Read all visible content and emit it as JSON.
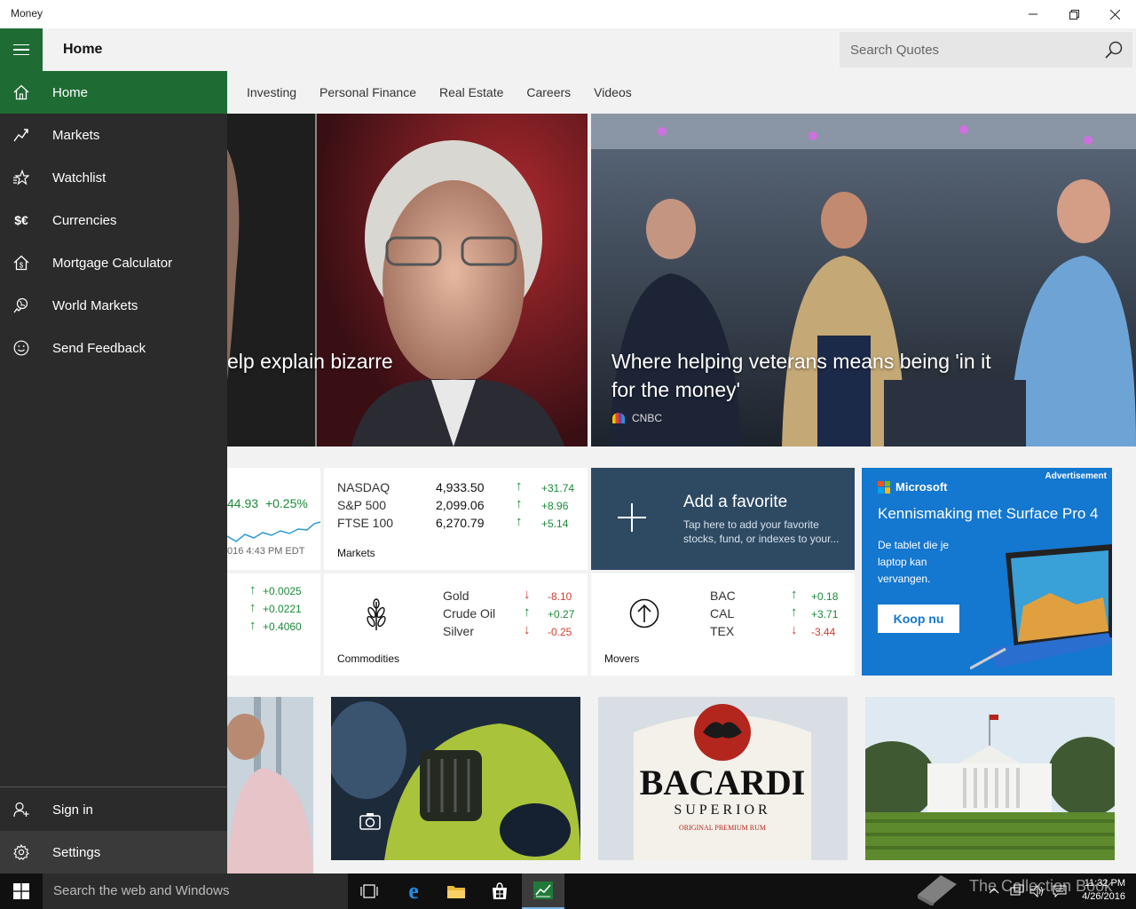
{
  "window": {
    "title": "Money",
    "min_icon": "minimize-icon",
    "max_icon": "restore-icon",
    "close_icon": "close-icon"
  },
  "header": {
    "page_title": "Home",
    "menu_icon": "hamburger-icon"
  },
  "search": {
    "placeholder": "Search Quotes",
    "icon": "search-icon"
  },
  "categories": [
    "Investing",
    "Personal Finance",
    "Real Estate",
    "Careers",
    "Videos"
  ],
  "hero": [
    {
      "headline": "elp explain bizarre"
    },
    {
      "headline": "Where helping veterans means being 'in it for the money'",
      "source": "CNBC"
    }
  ],
  "index_tile": {
    "value": "44.93",
    "change": "+0.25%",
    "timestamp": "016 4:43 PM EDT"
  },
  "markets_tile": {
    "label": "Markets",
    "rows": [
      {
        "name": "NASDAQ",
        "value": "4,933.50",
        "change": "+31.74",
        "dir": "up"
      },
      {
        "name": "S&P 500",
        "value": "2,099.06",
        "change": "+8.96",
        "dir": "up"
      },
      {
        "name": "FTSE 100",
        "value": "6,270.79",
        "change": "+5.14",
        "dir": "up"
      }
    ]
  },
  "currencies_tile": {
    "rows": [
      "+0.0025",
      "+0.0221",
      "+0.4060"
    ]
  },
  "commodities_tile": {
    "label": "Commodities",
    "icon": "wheat-icon",
    "rows": [
      {
        "name": "Gold",
        "change": "-8.10",
        "dir": "down"
      },
      {
        "name": "Crude Oil",
        "change": "+0.27",
        "dir": "up"
      },
      {
        "name": "Silver",
        "change": "-0.25",
        "dir": "down"
      }
    ]
  },
  "movers_tile": {
    "label": "Movers",
    "icon": "arrow-up-circle-icon",
    "rows": [
      {
        "name": "BAC",
        "change": "+0.18",
        "dir": "up"
      },
      {
        "name": "CAL",
        "change": "+3.71",
        "dir": "up"
      },
      {
        "name": "TEX",
        "change": "-3.44",
        "dir": "down"
      }
    ]
  },
  "favorite_tile": {
    "title": "Add a favorite",
    "subtitle": "Tap here to add your favorite stocks, fund, or indexes to your..."
  },
  "ad": {
    "label": "Advertisement",
    "brand": "Microsoft",
    "headline": "Kennismaking met Surface Pro 4",
    "body": "De tablet die je laptop kan vervangen.",
    "cta": "Koop nu"
  },
  "bottom_images": [
    {
      "name": "person-image"
    },
    {
      "name": "car-image",
      "icon": "camera-icon"
    },
    {
      "name": "bacardi-image",
      "brand": "BACARDI",
      "brand_sub": "SUPERIOR",
      "brand_line": "ORIGINAL PREMIUM RUM"
    },
    {
      "name": "white-house-image"
    }
  ],
  "sidebar": {
    "items": [
      {
        "label": "Home",
        "icon": "home-icon"
      },
      {
        "label": "Markets",
        "icon": "markets-icon"
      },
      {
        "label": "Watchlist",
        "icon": "watchlist-icon"
      },
      {
        "label": "Currencies",
        "icon": "currencies-icon"
      },
      {
        "label": "Mortgage Calculator",
        "icon": "mortgage-icon"
      },
      {
        "label": "World Markets",
        "icon": "world-markets-icon"
      },
      {
        "label": "Send Feedback",
        "icon": "feedback-icon"
      }
    ],
    "footer": [
      {
        "label": "Sign in",
        "icon": "person-add-icon"
      },
      {
        "label": "Settings",
        "icon": "gear-icon"
      }
    ]
  },
  "taskbar": {
    "search_placeholder": "Search the web and Windows",
    "clock_time": "11:32 PM",
    "clock_date": "4/26/2016",
    "watermark": "The Collection Book"
  }
}
